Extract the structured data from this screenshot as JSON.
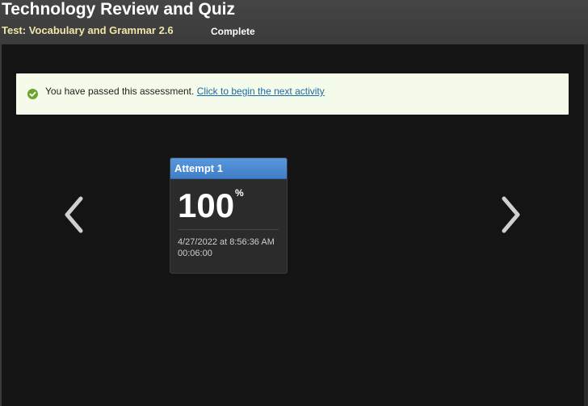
{
  "header": {
    "title": "Technology Review and Quiz",
    "subtitle": "Test: Vocabulary and Grammar 2.6",
    "status": "Complete"
  },
  "notice": {
    "icon": "check-circle-icon",
    "message": "You have passed this assessment.",
    "link_label": "Click to begin the next activity",
    "colors": {
      "background": "#f5fbea",
      "icon": "#6aa52e",
      "link": "#1a6aa8"
    }
  },
  "navigation": {
    "prev_icon": "chevron-left-icon",
    "next_icon": "chevron-right-icon"
  },
  "attempts": [
    {
      "label": "Attempt 1",
      "score": "100",
      "score_unit": "%",
      "date": "4/27/2022 at 8:56:36 AM",
      "duration": "00:06:00"
    }
  ],
  "colors": {
    "accent": "#4a8ad2",
    "content_background": "#141414",
    "subtitle": "#f0e6a8"
  }
}
